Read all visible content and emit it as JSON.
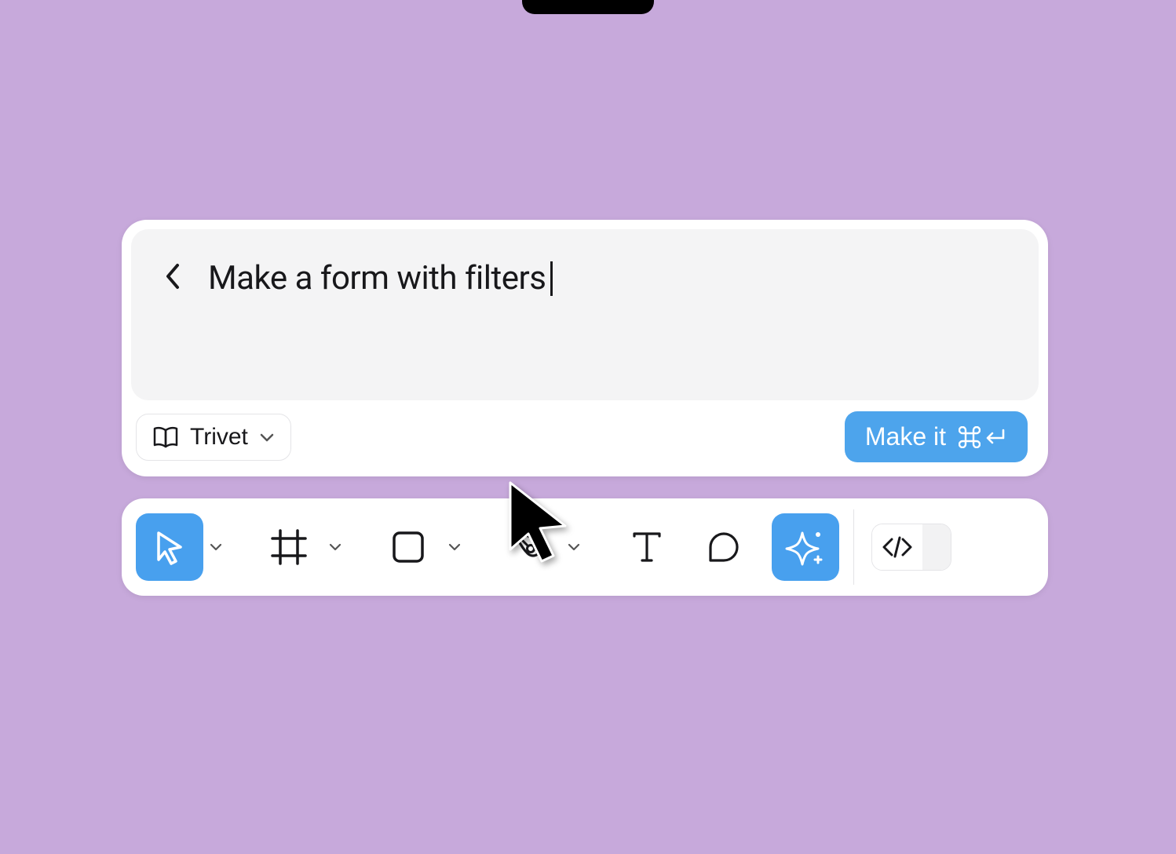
{
  "prompt": {
    "text": "Make a form with filters"
  },
  "library": {
    "label": "Trivet"
  },
  "primary_action": {
    "label": "Make it"
  },
  "tools": {
    "move": {
      "name": "move-tool",
      "active": true,
      "has_chevron": true
    },
    "frame": {
      "name": "frame-tool",
      "active": false,
      "has_chevron": true
    },
    "shape": {
      "name": "shape-tool",
      "active": false,
      "has_chevron": true
    },
    "pen": {
      "name": "pen-tool",
      "active": false,
      "has_chevron": true
    },
    "text": {
      "name": "text-tool",
      "active": false,
      "has_chevron": false
    },
    "comment": {
      "name": "comment-tool",
      "active": false,
      "has_chevron": false
    },
    "ai": {
      "name": "ai-tool",
      "active": true,
      "has_chevron": false
    }
  }
}
